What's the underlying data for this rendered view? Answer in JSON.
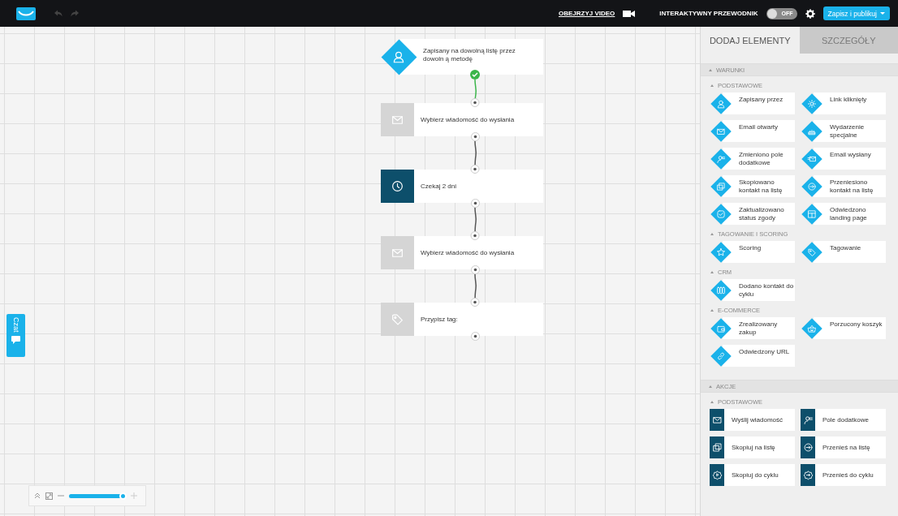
{
  "toolbar": {
    "watch_video": "OBEJRZYJ VIDEO",
    "guide_label": "INTERAKTYWNY PRZEWODNIK",
    "guide_toggle": {
      "label": "OFF",
      "on": false
    },
    "publish_button": "Zapisz i publikuj"
  },
  "canvas": {
    "nodes": [
      {
        "kind": "condition",
        "text": "Zapisany na dowolną listę przez dowoln ą metodę",
        "completed": true
      },
      {
        "kind": "message",
        "text": "Wybierz wiadomość do wysłania",
        "completed": false
      },
      {
        "kind": "wait",
        "text": "Czekaj 2 dni",
        "completed": false
      },
      {
        "kind": "message",
        "text": "Wybierz wiadomość do wysłania",
        "completed": false
      },
      {
        "kind": "tag",
        "text": "Przypisz tag:",
        "completed": false
      }
    ],
    "chat_button": "Czat",
    "zoom": {
      "level": 0.95
    }
  },
  "sidebar": {
    "tabs": [
      {
        "label": "DODAJ ELEMENTY",
        "selected": true
      },
      {
        "label": "SZCZEGÓŁY",
        "selected": false
      }
    ],
    "sections": [
      {
        "title": "WARUNKI",
        "expanded": true,
        "groups": [
          {
            "title": "PODSTAWOWE",
            "expanded": true,
            "items": [
              {
                "kind": "condition",
                "label": "Zapisany przez"
              },
              {
                "kind": "condition",
                "label": "Link kliknięty"
              },
              {
                "kind": "condition",
                "label": "Email otwarty"
              },
              {
                "kind": "condition",
                "label": "Wydarzenie specjalne"
              },
              {
                "kind": "condition",
                "label": "Zmieniono pole dodatkowe"
              },
              {
                "kind": "condition",
                "label": "Email wysłany"
              },
              {
                "kind": "condition",
                "label": "Skopiowano kontakt na listę"
              },
              {
                "kind": "condition",
                "label": "Przeniesiono kontakt na listę"
              },
              {
                "kind": "condition",
                "label": "Zaktualizowano status zgody"
              },
              {
                "kind": "condition",
                "label": "Odwiedzono landing page"
              }
            ]
          },
          {
            "title": "TAGOWANIE I SCORING",
            "expanded": true,
            "items": [
              {
                "kind": "condition",
                "label": "Scoring"
              },
              {
                "kind": "condition",
                "label": "Tagowanie"
              }
            ]
          },
          {
            "title": "CRM",
            "expanded": true,
            "items": [
              {
                "kind": "condition",
                "label": "Dodano kontakt do cyklu"
              }
            ]
          },
          {
            "title": "E-COMMERCE",
            "expanded": true,
            "items": [
              {
                "kind": "condition",
                "label": "Zrealizowany zakup"
              },
              {
                "kind": "condition",
                "label": "Porzucony koszyk"
              },
              {
                "kind": "condition",
                "label": "Odwiedzony URL"
              }
            ]
          }
        ]
      },
      {
        "title": "AKCJE",
        "expanded": true,
        "groups": [
          {
            "title": "PODSTAWOWE",
            "expanded": true,
            "items": [
              {
                "kind": "action",
                "label": "Wyślij wiadomość"
              },
              {
                "kind": "action",
                "label": "Pole dodatkowe"
              },
              {
                "kind": "action",
                "label": "Skopiuj na listę"
              },
              {
                "kind": "action",
                "label": "Przenieś na listę"
              },
              {
                "kind": "action",
                "label": "Skopiuj do cyklu"
              },
              {
                "kind": "action",
                "label": "Przenieś do cyklu"
              }
            ]
          }
        ]
      }
    ]
  }
}
